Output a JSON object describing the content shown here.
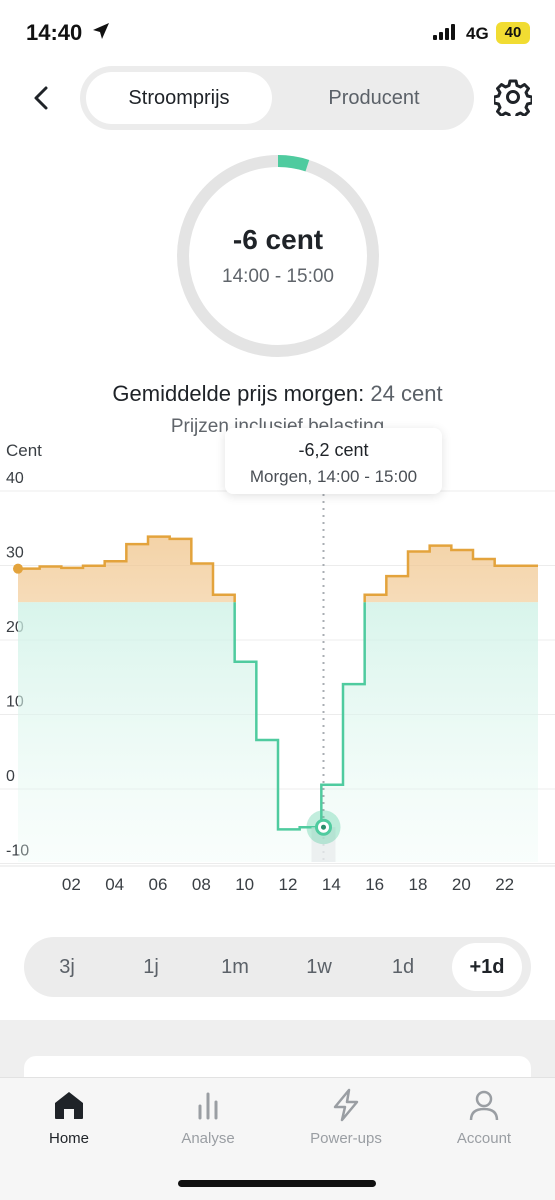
{
  "status": {
    "time": "14:40",
    "network": "4G",
    "battery": "40"
  },
  "header": {
    "tabs": [
      {
        "label": "Stroomprijs",
        "active": true
      },
      {
        "label": "Producent",
        "active": false
      }
    ]
  },
  "current": {
    "value": "-6 cent",
    "time_range": "14:00 - 15:00",
    "ring_fill_fraction": 0.05
  },
  "summary": {
    "avg_label": "Gemiddelde prijs morgen:",
    "avg_value": "24 cent",
    "note": "Prijzen inclusief belasting"
  },
  "tooltip": {
    "value": "-6,2 cent",
    "time": "Morgen, 14:00 - 15:00"
  },
  "colors": {
    "positive": "#e3a33c",
    "negative": "#4fcb9f",
    "accent": "#4fcb9f"
  },
  "chart_data": {
    "type": "line",
    "step": true,
    "ylabel": "Cent",
    "ylim": [
      -12,
      40
    ],
    "yticks": [
      40,
      30,
      20,
      10,
      0,
      -10
    ],
    "xticks": [
      "02",
      "04",
      "06",
      "08",
      "10",
      "12",
      "14",
      "16",
      "18",
      "20",
      "22"
    ],
    "x": [
      0,
      1,
      2,
      3,
      4,
      5,
      6,
      7,
      8,
      9,
      10,
      11,
      12,
      13,
      14,
      15,
      16,
      17,
      18,
      19,
      20,
      21,
      22,
      23
    ],
    "values": [
      28.5,
      28.8,
      28.6,
      28.9,
      29.5,
      31.8,
      32.8,
      32.5,
      29.2,
      25.0,
      16.0,
      5.5,
      -6.5,
      -6.2,
      -0.5,
      13.0,
      25.0,
      27.5,
      30.8,
      31.6,
      31.0,
      29.8,
      28.9,
      28.9
    ],
    "selected_index": 14,
    "selected_value": -6.2
  },
  "ranges": [
    {
      "label": "3j",
      "active": false
    },
    {
      "label": "1j",
      "active": false
    },
    {
      "label": "1m",
      "active": false
    },
    {
      "label": "1w",
      "active": false
    },
    {
      "label": "1d",
      "active": false
    },
    {
      "label": "+1d",
      "active": true
    }
  ],
  "nav": [
    {
      "label": "Home",
      "icon": "home-icon",
      "active": true
    },
    {
      "label": "Analyse",
      "icon": "bar-chart-icon",
      "active": false
    },
    {
      "label": "Power-ups",
      "icon": "lightning-icon",
      "active": false
    },
    {
      "label": "Account",
      "icon": "user-icon",
      "active": false
    }
  ]
}
